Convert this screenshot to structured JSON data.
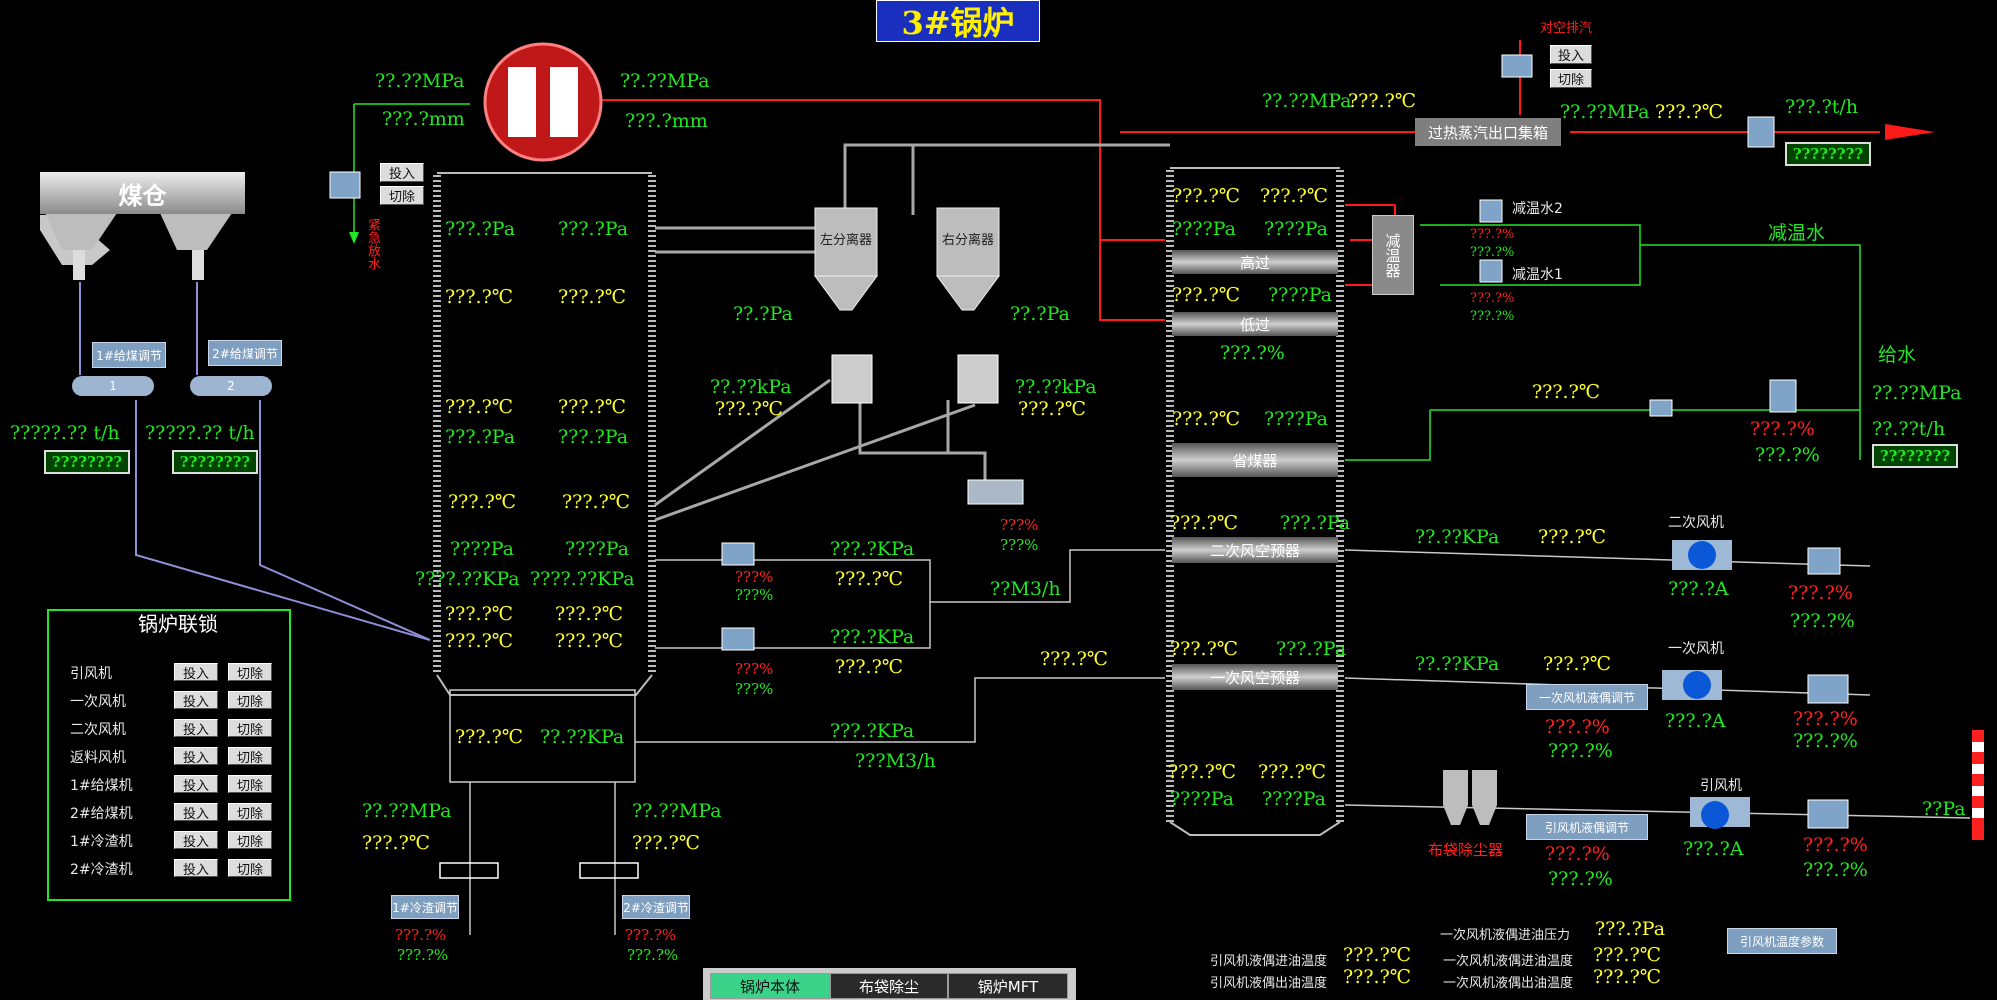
{
  "title": "3#锅炉",
  "tabs": [
    "锅炉本体",
    "布袋除尘",
    "锅炉MFT"
  ],
  "btn": {
    "in": "投入",
    "out": "切除"
  },
  "coal_bin": "煤仓",
  "feeder_adj": [
    "1#给煤调节",
    "2#给煤调节"
  ],
  "feeder_num": [
    "1",
    "2"
  ],
  "feeder_flow": [
    "?????.?? t/h",
    "?????.?? t/h"
  ],
  "total": "????????",
  "interlock": {
    "title": "锅炉联锁",
    "items": [
      "引风机",
      "一次风机",
      "二次风机",
      "返料风机",
      "1#给煤机",
      "2#给煤机",
      "1#冷渣机",
      "2#冷渣机"
    ]
  },
  "drum": {
    "p": "??.??MPa",
    "l": "???.?mm"
  },
  "emergency": "紧急放水",
  "separators": [
    "左分离器",
    "右分离器"
  ],
  "vent": "对空排汽",
  "header": "过热蒸汽出口集箱",
  "desuperheater": "减温器",
  "desup_water": [
    "减温水2",
    "减温水1"
  ],
  "desup_water_label": "减温水",
  "feed_water": "给水",
  "sections": [
    "高过",
    "低过",
    "省煤器",
    "二次风空预器",
    "一次风空预器"
  ],
  "fans": [
    "二次风机",
    "一次风机",
    "引风机"
  ],
  "fan_adj": [
    "一次风机液偶调节",
    "引风机液偶调节"
  ],
  "bag_filter": "布袋除尘器",
  "slag_adj": [
    "1#冷渣调节",
    "2#冷渣调节"
  ],
  "fan_temp_btn": "引风机温度参数",
  "oil": [
    "一次风机液偶进油压力",
    "引风机液偶进油温度",
    "一次风机液偶进油温度",
    "引风机液偶出油温度",
    "一次风机液偶出油温度"
  ],
  "v": {
    "pa": "???.?Pa",
    "c": "???.?℃",
    "c2": "???.?℃",
    "pa4": "????Pa",
    "kpa5": "????.??KPa",
    "pa2": "??.?Pa",
    "kpa2": "??.??kPa",
    "kpa1": "???.?KPa",
    "pct3": "???%",
    "pct": "???.?%",
    "m3h": "??M3/h",
    "m3h3": "???M3/h",
    "kpa22": "??.??KPa",
    "amp": "???.?A",
    "pa_end": "??Pa",
    "mpa": "??.??MPa",
    "th": "???.?t/h",
    "mpa_th": "??.??t/h",
    "cPa": "???.?Pa"
  }
}
